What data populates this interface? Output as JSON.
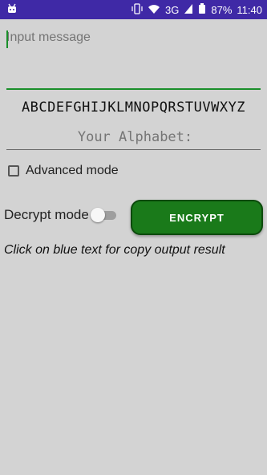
{
  "status_bar": {
    "battery_percent": "87%",
    "time": "11:40",
    "network": "3G",
    "icons": [
      "android-debug-icon",
      "vibrate-icon",
      "wifi-icon",
      "signal-icon",
      "battery-icon"
    ]
  },
  "input": {
    "placeholder": "Input message",
    "value": ""
  },
  "alphabet": {
    "reference": "ABCDEFGHIJKLMNOPQRSTUVWXYZ",
    "custom_placeholder": "Your Alphabet:"
  },
  "advanced": {
    "label": "Advanced mode",
    "checked": false
  },
  "decrypt": {
    "label": "Decrypt mode",
    "enabled": false
  },
  "encrypt_button": {
    "label": "ENCRYPT"
  },
  "hint": "Click on blue text for copy output result",
  "colors": {
    "status_bar": "#3f29a6",
    "accent": "#1a8f2a",
    "button": "#1a7a1a",
    "background": "#d3d3d3"
  }
}
